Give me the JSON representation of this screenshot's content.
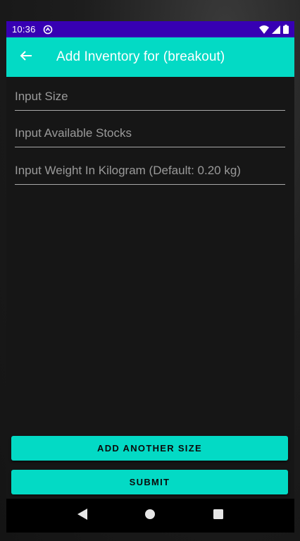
{
  "status_bar": {
    "time": "10:36",
    "icons": [
      "sync-status-icon",
      "wifi-icon",
      "signal-icon",
      "battery-icon"
    ]
  },
  "app_bar": {
    "title": "Add Inventory for (breakout)",
    "back_icon": "arrow-back-icon"
  },
  "form": {
    "size_placeholder": "Input Size",
    "stocks_placeholder": "Input Available Stocks",
    "weight_placeholder": "Input Weight In Kilogram (Default: 0.20 kg)"
  },
  "actions": {
    "add_another_label": "ADD ANOTHER SIZE",
    "submit_label": "SUBMIT"
  },
  "nav_bar": {
    "icons": [
      "nav-back-icon",
      "nav-home-icon",
      "nav-recents-icon"
    ]
  },
  "colors": {
    "status_bar": "#3700b3",
    "accent": "#03dac5",
    "background": "#161616"
  }
}
